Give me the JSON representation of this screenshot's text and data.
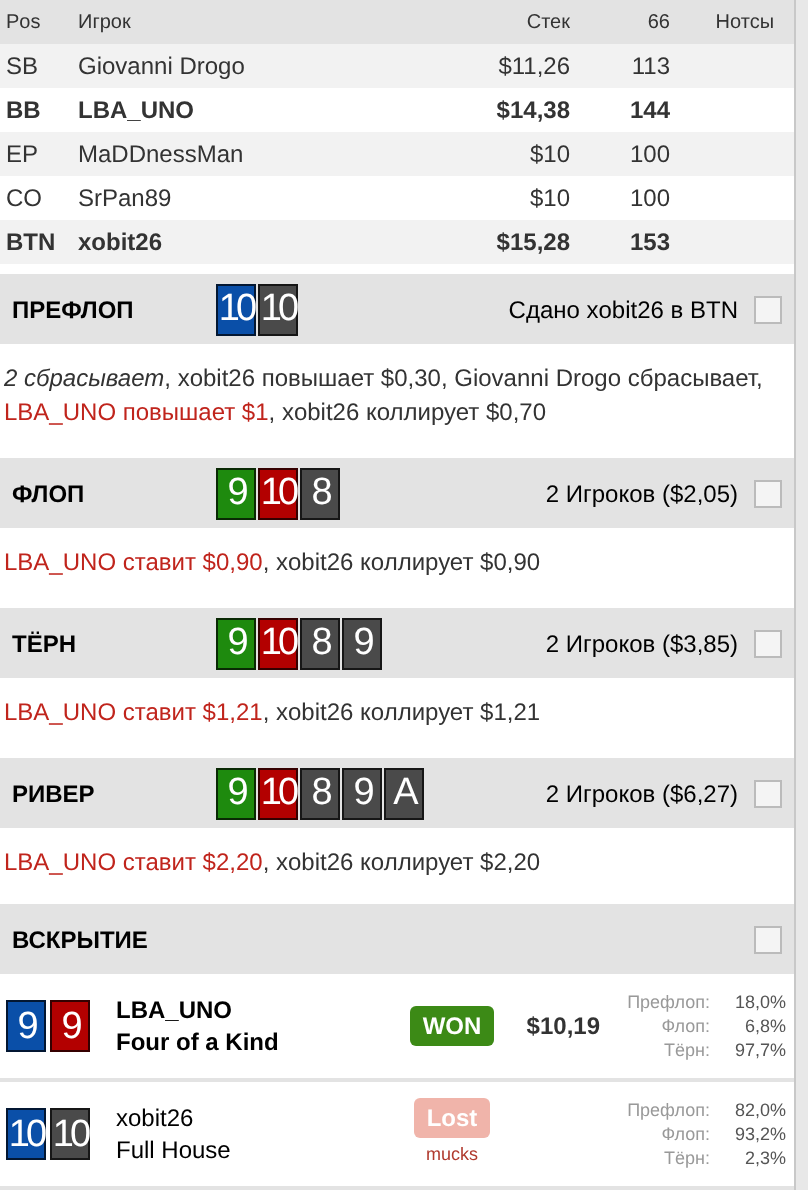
{
  "players": {
    "columns": [
      "Pos",
      "Игрок",
      "Стек",
      "66",
      "Нотсы"
    ],
    "rows": [
      {
        "pos": "SB",
        "name": "Giovanni Drogo",
        "stack": "$11,26",
        "bb": "113",
        "bold": false
      },
      {
        "pos": "BB",
        "name": "LBA_UNO",
        "stack": "$14,38",
        "bb": "144",
        "bold": true
      },
      {
        "pos": "EP",
        "name": "MaDDnessMan",
        "stack": "$10",
        "bb": "100",
        "bold": false
      },
      {
        "pos": "CO",
        "name": "SrPan89",
        "stack": "$10",
        "bb": "100",
        "bold": false
      },
      {
        "pos": "BTN",
        "name": "xobit26",
        "stack": "$15,28",
        "bb": "153",
        "bold": true
      }
    ]
  },
  "streets": [
    {
      "title": "ПРЕФЛОП",
      "info": "Сдано xobit26 в BTN",
      "note_checked": false,
      "cards": [
        {
          "rank": "10",
          "color": "#0a4fa8"
        },
        {
          "rank": "10",
          "color": "#4a4a4a"
        }
      ],
      "actions": [
        {
          "text": "2 сбрасывает",
          "kind": "folded"
        },
        {
          "text": ", xobit26 повышает $0,30, Giovanni Drogo сбрасывает, ",
          "kind": "plain"
        },
        {
          "text": "LBA_UNO повышает $1",
          "kind": "highlight"
        },
        {
          "text": ", xobit26 коллирует $0,70",
          "kind": "plain"
        }
      ]
    },
    {
      "title": "ФЛОП",
      "info": "2 Игроков ($2,05)",
      "note_checked": false,
      "cards": [
        {
          "rank": "9",
          "color": "#1e8a0e"
        },
        {
          "rank": "10",
          "color": "#b30000"
        },
        {
          "rank": "8",
          "color": "#4a4a4a"
        }
      ],
      "actions": [
        {
          "text": "LBA_UNO ставит $0,90",
          "kind": "highlight"
        },
        {
          "text": ", xobit26 коллирует $0,90",
          "kind": "plain"
        }
      ]
    },
    {
      "title": "ТЁРН",
      "info": "2 Игроков ($3,85)",
      "note_checked": false,
      "cards": [
        {
          "rank": "9",
          "color": "#1e8a0e"
        },
        {
          "rank": "10",
          "color": "#b30000"
        },
        {
          "rank": "8",
          "color": "#4a4a4a"
        },
        {
          "rank": "9",
          "color": "#4a4a4a"
        }
      ],
      "actions": [
        {
          "text": "LBA_UNO ставит $1,21",
          "kind": "highlight"
        },
        {
          "text": ", xobit26 коллирует $1,21",
          "kind": "plain"
        }
      ]
    },
    {
      "title": "РИВЕР",
      "info": "2 Игроков ($6,27)",
      "note_checked": false,
      "cards": [
        {
          "rank": "9",
          "color": "#1e8a0e"
        },
        {
          "rank": "10",
          "color": "#b30000"
        },
        {
          "rank": "8",
          "color": "#4a4a4a"
        },
        {
          "rank": "9",
          "color": "#4a4a4a"
        },
        {
          "rank": "A",
          "color": "#4a4a4a"
        }
      ],
      "actions": [
        {
          "text": "LBA_UNO ставит $2,20",
          "kind": "highlight"
        },
        {
          "text": ", xobit26 коллирует $2,20",
          "kind": "plain"
        }
      ]
    }
  ],
  "showdown": {
    "title": "ВСКРЫТИЕ",
    "note_checked": false,
    "players": [
      {
        "name": "LBA_UNO",
        "hand": "Four of a Kind",
        "result": "WON",
        "won": true,
        "amount": "$10,19",
        "cards": [
          {
            "rank": "9",
            "color": "#0a4fa8"
          },
          {
            "rank": "9",
            "color": "#b30000"
          }
        ],
        "equity": [
          {
            "label": "Префлоп:",
            "value": "18,0%"
          },
          {
            "label": "Флоп:",
            "value": "6,8%"
          },
          {
            "label": "Тёрн:",
            "value": "97,7%"
          }
        ]
      },
      {
        "name": "xobit26",
        "hand": "Full House",
        "result": "Lost",
        "won": false,
        "note": "mucks",
        "cards": [
          {
            "rank": "10",
            "color": "#0a4fa8"
          },
          {
            "rank": "10",
            "color": "#4a4a4a"
          }
        ],
        "equity": [
          {
            "label": "Префлоп:",
            "value": "82,0%"
          },
          {
            "label": "Флоп:",
            "value": "93,2%"
          },
          {
            "label": "Тёрн:",
            "value": "2,3%"
          }
        ]
      }
    ]
  }
}
